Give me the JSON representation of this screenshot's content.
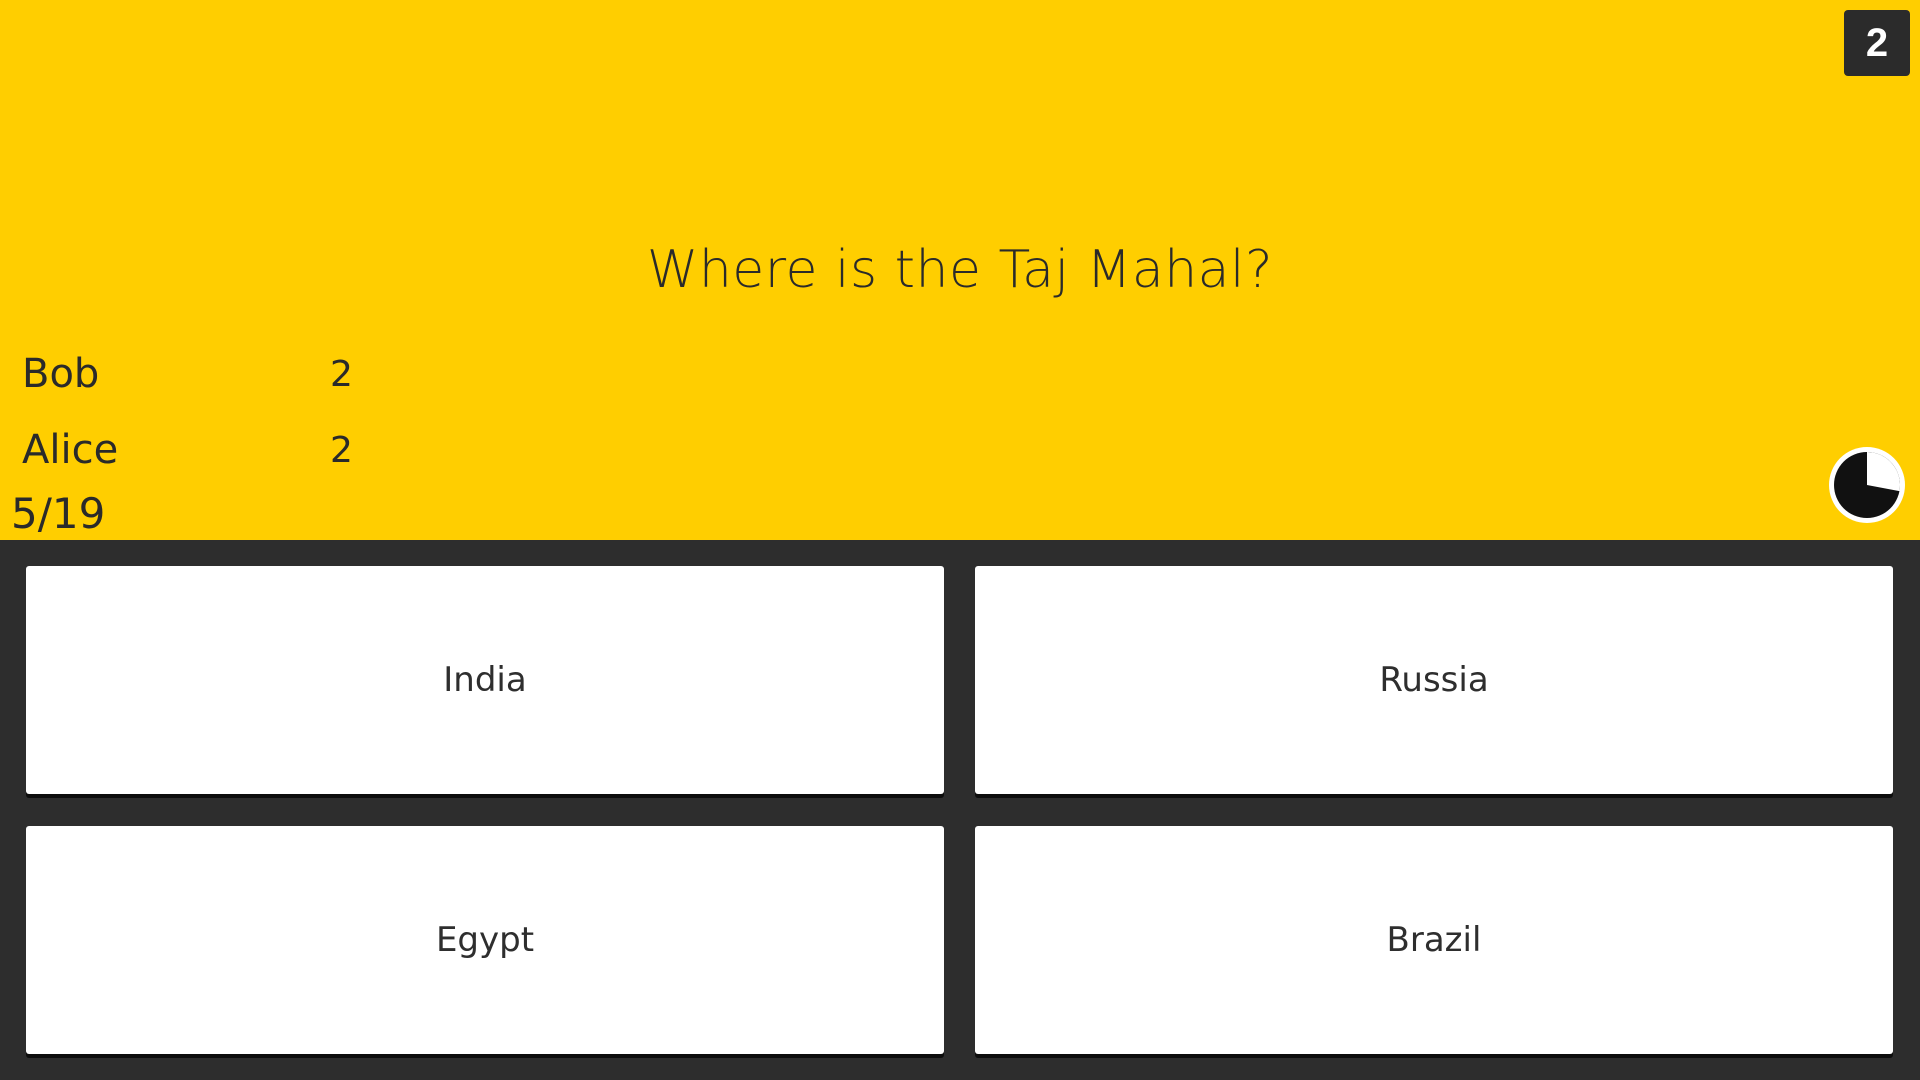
{
  "colors": {
    "top_panel": "#ffce00",
    "answer_area": "#2d2d2d",
    "answer_card": "#ffffff",
    "text_dark": "#2a2a2a",
    "badge": "#2b2b2b"
  },
  "round_badge": "2",
  "question": "Where is the Taj Mahal?",
  "scores": [
    {
      "name": "Bob",
      "score": "2"
    },
    {
      "name": "Alice",
      "score": "2"
    }
  ],
  "progress": "5/19",
  "timer": {
    "icon": "pie-timer-icon",
    "remaining_fraction": 0.72
  },
  "answers": [
    {
      "label": "India"
    },
    {
      "label": "Russia"
    },
    {
      "label": "Egypt"
    },
    {
      "label": "Brazil"
    }
  ]
}
